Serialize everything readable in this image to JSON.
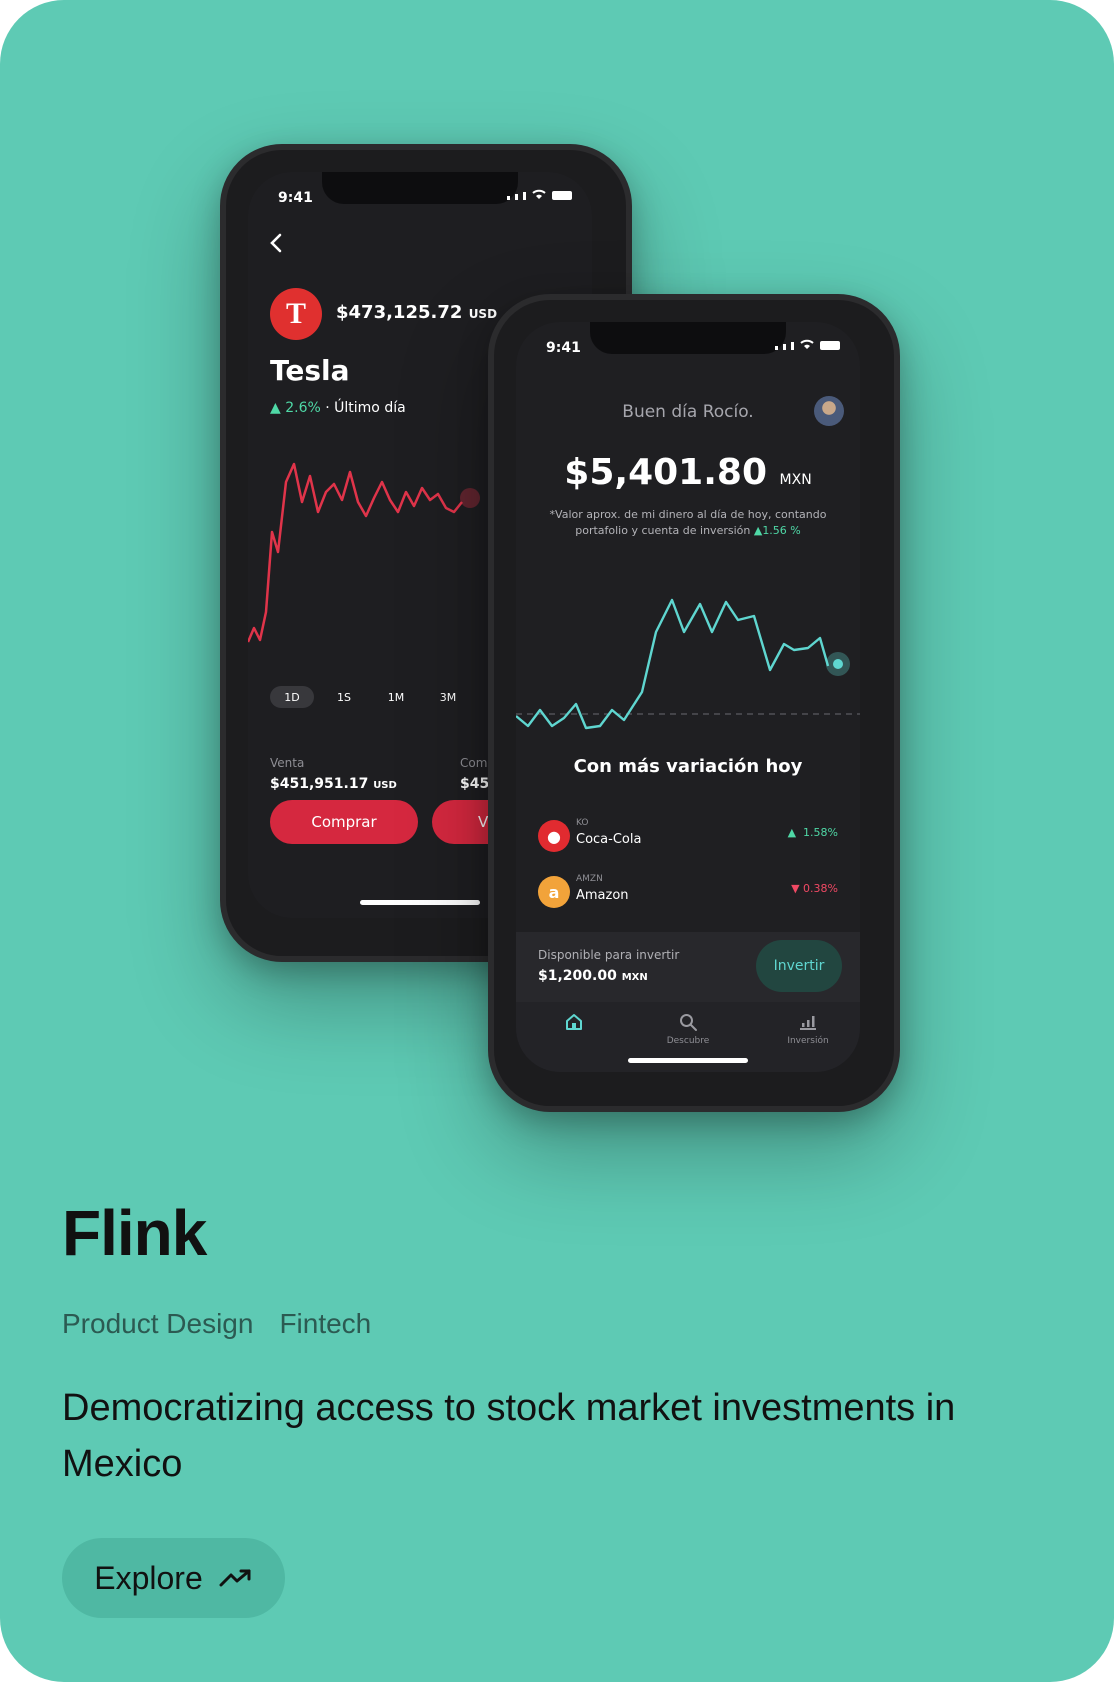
{
  "card": {
    "title": "Flink",
    "tags": [
      "Product Design",
      "Fintech"
    ],
    "description": "Democratizing access to stock market investments in Mexico",
    "explore_label": "Explore",
    "explore_icon": "trending-up-icon"
  },
  "back_phone": {
    "time": "9:41",
    "back_icon": "chevron-left-icon",
    "price": "$473,125.72",
    "price_currency": "USD",
    "stock_name": "Tesla",
    "change": "2.6%",
    "change_period": "· Último día",
    "ranges": [
      "1D",
      "1S",
      "1M",
      "3M"
    ],
    "sell_label": "Venta",
    "sell_value": "$451,951.17",
    "sell_currency": "USD",
    "buy_label_partial": "Com",
    "buy_value_partial": "$45",
    "buy_button": "Comprar",
    "sell_button_partial": "V"
  },
  "front_phone": {
    "time": "9:41",
    "greeting": "Buen día Rocío.",
    "balance": "$5,401.80",
    "balance_currency": "MXN",
    "note_line1": "*Valor aprox. de mi dinero al día de hoy, contando",
    "note_line2": "portafolio y cuenta de inversión",
    "note_change": "1.56 %",
    "section_title": "Con más variación hoy",
    "stocks": [
      {
        "ticker": "KO",
        "name": "Coca-Cola",
        "change": "1.58%",
        "direction": "up"
      },
      {
        "ticker": "AMZN",
        "name": "Amazon",
        "change": "0.38%",
        "direction": "down"
      }
    ],
    "available_label": "Disponible para invertir",
    "available_value": "$1,200.00",
    "available_currency": "MXN",
    "invest_button": "Invertir",
    "nav": [
      {
        "icon": "home-icon",
        "label": ""
      },
      {
        "icon": "search-icon",
        "label": "Descubre"
      },
      {
        "icon": "chart-icon",
        "label": "Inversión"
      }
    ]
  },
  "colors": {
    "card_bg": "#5ecab4",
    "accent_green": "#4fd8a6",
    "accent_red": "#e0302f",
    "line_teal": "#5fd6d0"
  }
}
